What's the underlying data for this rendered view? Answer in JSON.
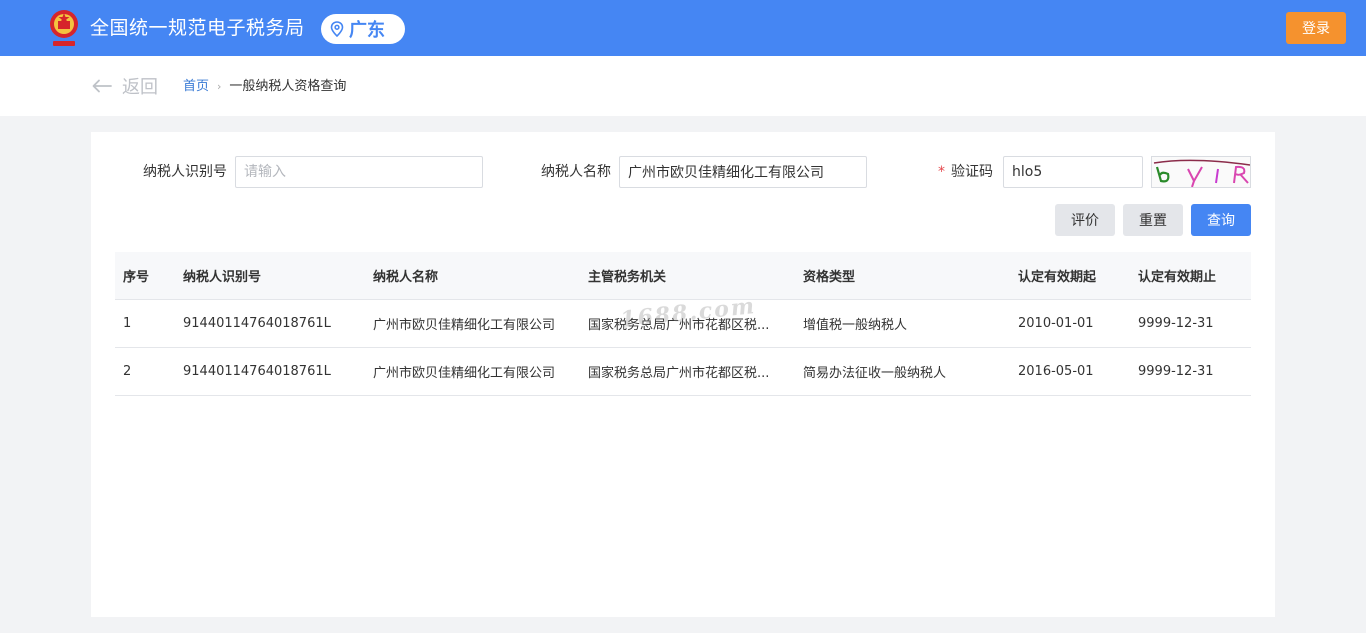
{
  "header": {
    "title": "全国统一规范电子税务局",
    "region": "广东",
    "login_label": "登录",
    "brand_color": "#4586f3",
    "login_color": "#f5922e"
  },
  "subnav": {
    "back_label": "返回",
    "breadcrumb_home": "首页",
    "breadcrumb_current": "一般纳税人资格查询"
  },
  "form": {
    "taxpayer_id": {
      "label": "纳税人识别号",
      "value": "",
      "placeholder": "请输入"
    },
    "taxpayer_name": {
      "label": "纳税人名称",
      "value": "广州市欧贝佳精细化工有限公司"
    },
    "captcha": {
      "required_mark": "*",
      "label": "验证码",
      "value": "hlo5"
    }
  },
  "actions": {
    "evaluate_label": "评价",
    "reset_label": "重置",
    "query_label": "查询"
  },
  "table": {
    "columns": [
      "序号",
      "纳税人识别号",
      "纳税人名称",
      "主管税务机关",
      "资格类型",
      "认定有效期起",
      "认定有效期止"
    ],
    "rows": [
      [
        "1",
        "91440114764018761L",
        "广州市欧贝佳精细化工有限公司",
        "国家税务总局广州市花都区税...",
        "增值税一般纳税人",
        "2010-01-01",
        "9999-12-31"
      ],
      [
        "2",
        "91440114764018761L",
        "广州市欧贝佳精细化工有限公司",
        "国家税务总局广州市花都区税...",
        "简易办法征收一般纳税人",
        "2016-05-01",
        "9999-12-31"
      ]
    ]
  },
  "watermark": "1688.com"
}
